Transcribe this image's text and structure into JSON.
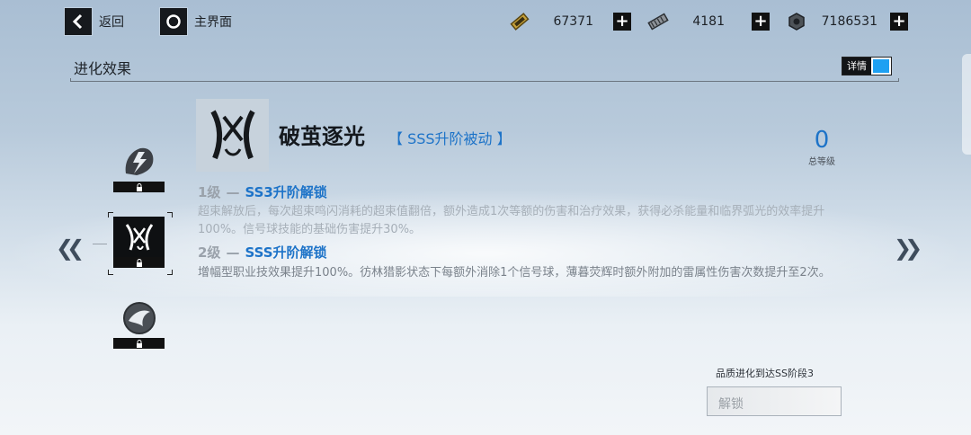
{
  "topbar": {
    "back_label": "返回",
    "home_label": "主界面",
    "resources": [
      {
        "icon": "gold-bar-icon",
        "value": "67371"
      },
      {
        "icon": "ammo-clip-icon",
        "value": "4181"
      },
      {
        "icon": "gear-nut-icon",
        "value": "7186531"
      }
    ]
  },
  "header": {
    "title": "进化效果",
    "detail_label": "详情",
    "detail_on": true
  },
  "skill": {
    "name": "破茧逐光",
    "tag": "【 SSS升阶被动 】",
    "level": "0",
    "level_label": "总等级",
    "tiers": [
      {
        "lv": "1级",
        "sep": "—",
        "name": "SS3升阶解锁",
        "desc": "超束解放后，每次超束鸣闪消耗的超束值翻倍，额外造成1次等额的伤害和治疗效果，获得必杀能量和临界弧光的效率提升100%。信号球技能的基础伤害提升30%。"
      },
      {
        "lv": "2级",
        "sep": "—",
        "name": "SSS升阶解锁",
        "desc": "增幅型职业技效果提升100%。彷林猎影状态下每额外消除1个信号球，薄暮荧辉时额外附加的雷属性伤害次数提升至2次。"
      }
    ]
  },
  "footer": {
    "condition": "品质进化到达SS阶段3",
    "unlock_label": "解锁"
  },
  "colors": {
    "accent": "#1d73c8",
    "toggle": "#1da0f2"
  }
}
